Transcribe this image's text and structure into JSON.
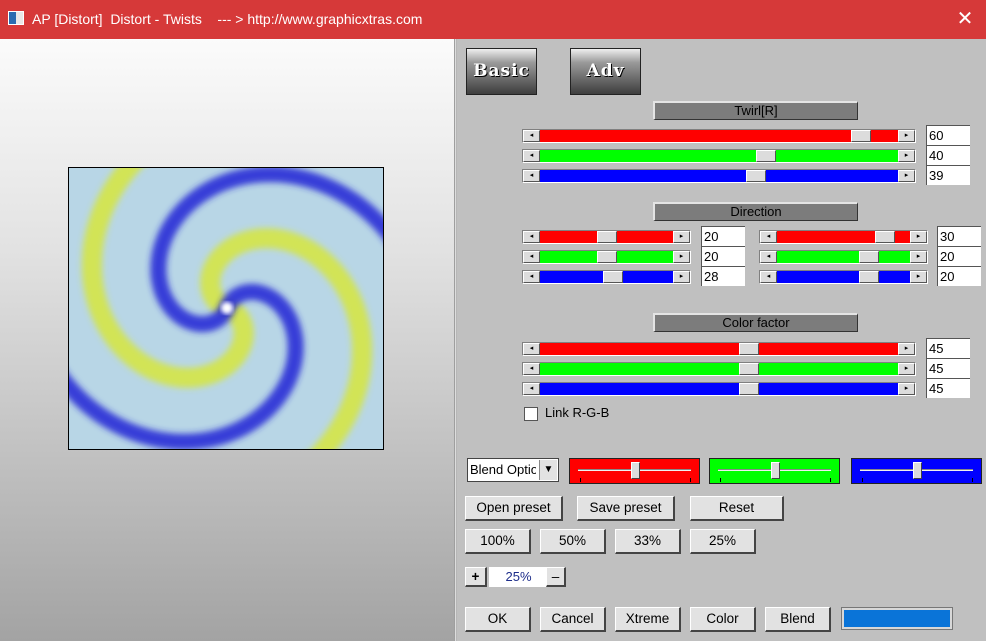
{
  "window": {
    "title": "AP [Distort]  Distort - Twists    --- > http://www.graphicxtras.com",
    "close_glyph": "✕"
  },
  "tabs": [
    {
      "label": "Basic"
    },
    {
      "label": "Adv"
    }
  ],
  "twirl": {
    "title": "Twirl[R]",
    "sliders": [
      {
        "color": "#ff0000",
        "value": "60",
        "fraction": 0.92
      },
      {
        "color": "#00ff00",
        "value": "40",
        "fraction": 0.64
      },
      {
        "color": "#0000ff",
        "value": "39",
        "fraction": 0.61
      }
    ]
  },
  "direction": {
    "title": "Direction",
    "left": [
      {
        "color": "#ff0000",
        "value": "20",
        "fraction": 0.5
      },
      {
        "color": "#00ff00",
        "value": "20",
        "fraction": 0.5
      },
      {
        "color": "#0000ff",
        "value": "28",
        "fraction": 0.56
      }
    ],
    "right": [
      {
        "color": "#ff0000",
        "value": "30",
        "fraction": 0.87
      },
      {
        "color": "#00ff00",
        "value": "20",
        "fraction": 0.73
      },
      {
        "color": "#0000ff",
        "value": "20",
        "fraction": 0.73
      }
    ]
  },
  "color_factor": {
    "title": "Color factor",
    "sliders": [
      {
        "color": "#ff0000",
        "value": "45",
        "fraction": 0.59
      },
      {
        "color": "#00ff00",
        "value": "45",
        "fraction": 0.59
      },
      {
        "color": "#0000ff",
        "value": "45",
        "fraction": 0.59
      }
    ]
  },
  "link_rgb": {
    "label": "Link R-G-B",
    "checked": false
  },
  "blend_options": {
    "value": "Blend Options",
    "arrow": "▼"
  },
  "color_sliders": [
    {
      "color": "#ff0000",
      "fraction": 0.5
    },
    {
      "color": "#00ff00",
      "fraction": 0.5
    },
    {
      "color": "#0000ff",
      "fraction": 0.5
    }
  ],
  "buttons": {
    "open_preset": "Open preset",
    "save_preset": "Save preset",
    "reset": "Reset",
    "zoom_100": "100%",
    "zoom_50": "50%",
    "zoom_33": "33%",
    "zoom_25": "25%",
    "zoom_plus": "+",
    "zoom_minus": "–",
    "ok": "OK",
    "cancel": "Cancel",
    "xtreme": "Xtreme",
    "color": "Color",
    "blend": "Blend"
  },
  "zoom_value": "25%",
  "swatch_color": "#0a74d8",
  "slider_arrows": {
    "left": "◂",
    "right": "▸"
  }
}
